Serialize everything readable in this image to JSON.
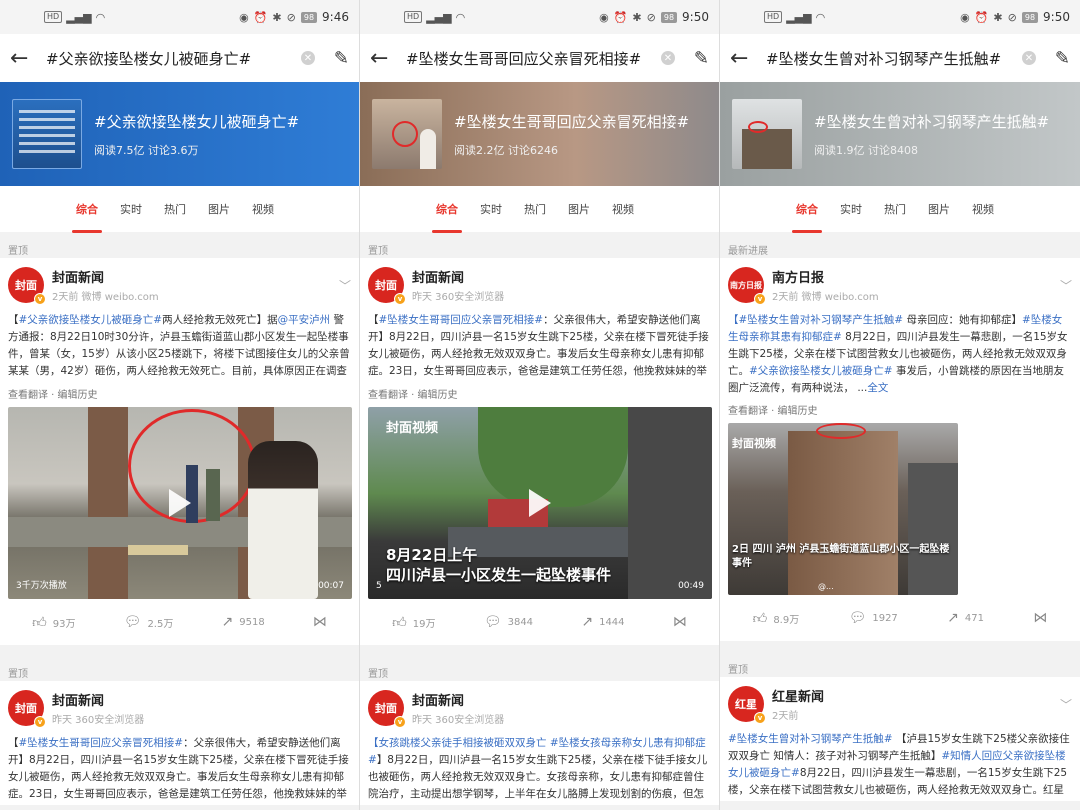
{
  "screens": [
    {
      "status": {
        "time": "9:46",
        "battery": "98",
        "signal": "4G"
      },
      "nav": {
        "title": "#父亲欲接坠楼女儿被砸身亡#"
      },
      "banner": {
        "title": "#父亲欲接坠楼女儿被砸身亡#",
        "stats": "阅读7.5亿  讨论3.6万"
      },
      "tabs": [
        "综合",
        "实时",
        "热门",
        "图片",
        "视频"
      ],
      "label": "置顶",
      "post": {
        "logo": "封面",
        "author": "封面新闻",
        "meta": "2天前  微博 weibo.com",
        "tag": "#父亲欲接坠楼女儿被砸身亡#",
        "text": "两人经抢救无效死亡】据",
        "mention": "@平安泸州",
        "text2": " 警方通报：8月22日10时30分许，泸县玉蟾街道蓝山郡小区发生一起坠楼事件，曾某（女，15岁）从该小区25楼跳下，将楼下试图接住女儿的父亲曾某某（男，42岁）砸伤，两人经抢救无效死亡。目前，具体原因正在调查中。请广大网友尊重死者和家 ...",
        "more": "全文",
        "sub": "查看翻译 · 编辑历史",
        "video_left": "3千万次播放",
        "video_right": "00:07",
        "likes": "93万",
        "comments": "2.5万",
        "reposts": "9518"
      },
      "label2": "置顶",
      "post2": {
        "logo": "封面",
        "author": "封面新闻",
        "meta": "昨天  360安全浏览器",
        "tag": "#坠楼女生哥哥回应父亲冒死相接#",
        "text": "：父亲很伟大，希望安静送他们离开】8月22日，四川泸县一名15岁女生跳下25楼，父亲在楼下冒死徒手接女儿被砸伤，两人经抢救无效双双身亡。事发后女生母亲称女儿患有抑郁症。23日，女生哥哥回应表示，爸爸是建筑工任劳任怨，他挽救妹妹的举动很伟"
      }
    },
    {
      "status": {
        "time": "9:50",
        "battery": "98",
        "signal": "4G"
      },
      "nav": {
        "title": "#坠楼女生哥哥回应父亲冒死相接#"
      },
      "banner": {
        "title": "#坠楼女生哥哥回应父亲冒死相接#",
        "stats": "阅读2.2亿  讨论6246"
      },
      "tabs": [
        "综合",
        "实时",
        "热门",
        "图片",
        "视频"
      ],
      "label": "置顶",
      "post": {
        "logo": "封面",
        "author": "封面新闻",
        "meta": "昨天  360安全浏览器",
        "tag": "#坠楼女生哥哥回应父亲冒死相接#",
        "text": "：父亲很伟大，希望安静送他们离开】8月22日，四川泸县一名15岁女生跳下25楼，父亲在楼下冒死徒手接女儿被砸伤，两人经抢救无效双双身亡。事发后女生母亲称女儿患有抑郁症。23日，女生哥哥回应表示，爸爸是建筑工任劳任怨，他挽救妹妹的举动很伟大，希望可以安静送他 ...",
        "more": "全文",
        "sub": "查看翻译 · 编辑历史",
        "video_brand": "封面视频",
        "video_caption_1": "8月22日上午",
        "video_caption_2": "四川泸县一小区发生一起坠楼事件",
        "video_left": "5",
        "video_right": "00:49",
        "likes": "19万",
        "comments": "3844",
        "reposts": "1444"
      },
      "label2": "置顶",
      "post2": {
        "logo": "封面",
        "author": "封面新闻",
        "meta": "昨天  360安全浏览器",
        "tag": "【女孩跳楼父亲徒手相接被砸双双身亡",
        "tag2": "#坠楼女孩母亲称女儿患有抑郁症#",
        "text": "】8月22日，四川泸县一名15岁女生跳下25楼，父亲在楼下徒手接女儿也被砸伤，两人经抢救无效双双身亡。女孩母亲称，女儿患有抑郁症曾住院治疗，主动提出想学钢琴，上半年在女儿胳膊上发现划割的伤痕，但怎么问她"
      }
    },
    {
      "status": {
        "time": "9:50",
        "battery": "98",
        "signal": "4G"
      },
      "nav": {
        "title": "#坠楼女生曾对补习钢琴产生抵触#"
      },
      "banner": {
        "title": "#坠楼女生曾对补习钢琴产生抵触#",
        "stats": "阅读1.9亿  讨论8408"
      },
      "tabs": [
        "综合",
        "实时",
        "热门",
        "图片",
        "视频"
      ],
      "label": "最新进展",
      "post": {
        "logo": "南方日报",
        "author": "南方日报",
        "meta": "2天前  微博 weibo.com",
        "tag": "【#坠楼女生曾对补习钢琴产生抵触#",
        "text": " 母亲回应：她有抑郁症】",
        "tag2": "#坠楼女生母亲称其患有抑郁症#",
        "text2": "8月22日，四川泸县发生一幕悲剧，一名15岁女生跳下25楼，父亲在楼下试图营救女儿也被砸伤，两人经抢救无效双双身亡。",
        "tag3": "#父亲欲接坠楼女儿被砸身亡#",
        "text3": "事发后，小曾跳楼的原因在当地朋友圈广泛流传，有两种说法， ...",
        "more": "全文",
        "sub": "查看翻译 · 编辑历史",
        "video_brand": "封面视频",
        "video_caption": "2日 四川 泸州 泸县玉蟾街道蓝山郡小区一起坠楼事件",
        "video_wm": "@...",
        "likes": "8.9万",
        "comments": "1927",
        "reposts": "471"
      },
      "label2": "置顶",
      "post2": {
        "logo": "红星",
        "author": "红星新闻",
        "meta": "2天前",
        "tag": "#坠楼女生曾对补习钢琴产生抵触#",
        "text": " 【泸县15岁女生跳下25楼父亲欲接住双双身亡 知情人：孩子对补习钢琴产生抵触】",
        "tag2": "#知情人回应父亲欲接坠楼女儿被砸身亡#",
        "text2": "8月22日，四川泸县发生一幕悲剧，一名15岁女生跳下25楼，父亲在楼下试图营救女儿也被砸伤，两人经抢救无效双双身亡。红星新闻记者从"
      }
    }
  ]
}
